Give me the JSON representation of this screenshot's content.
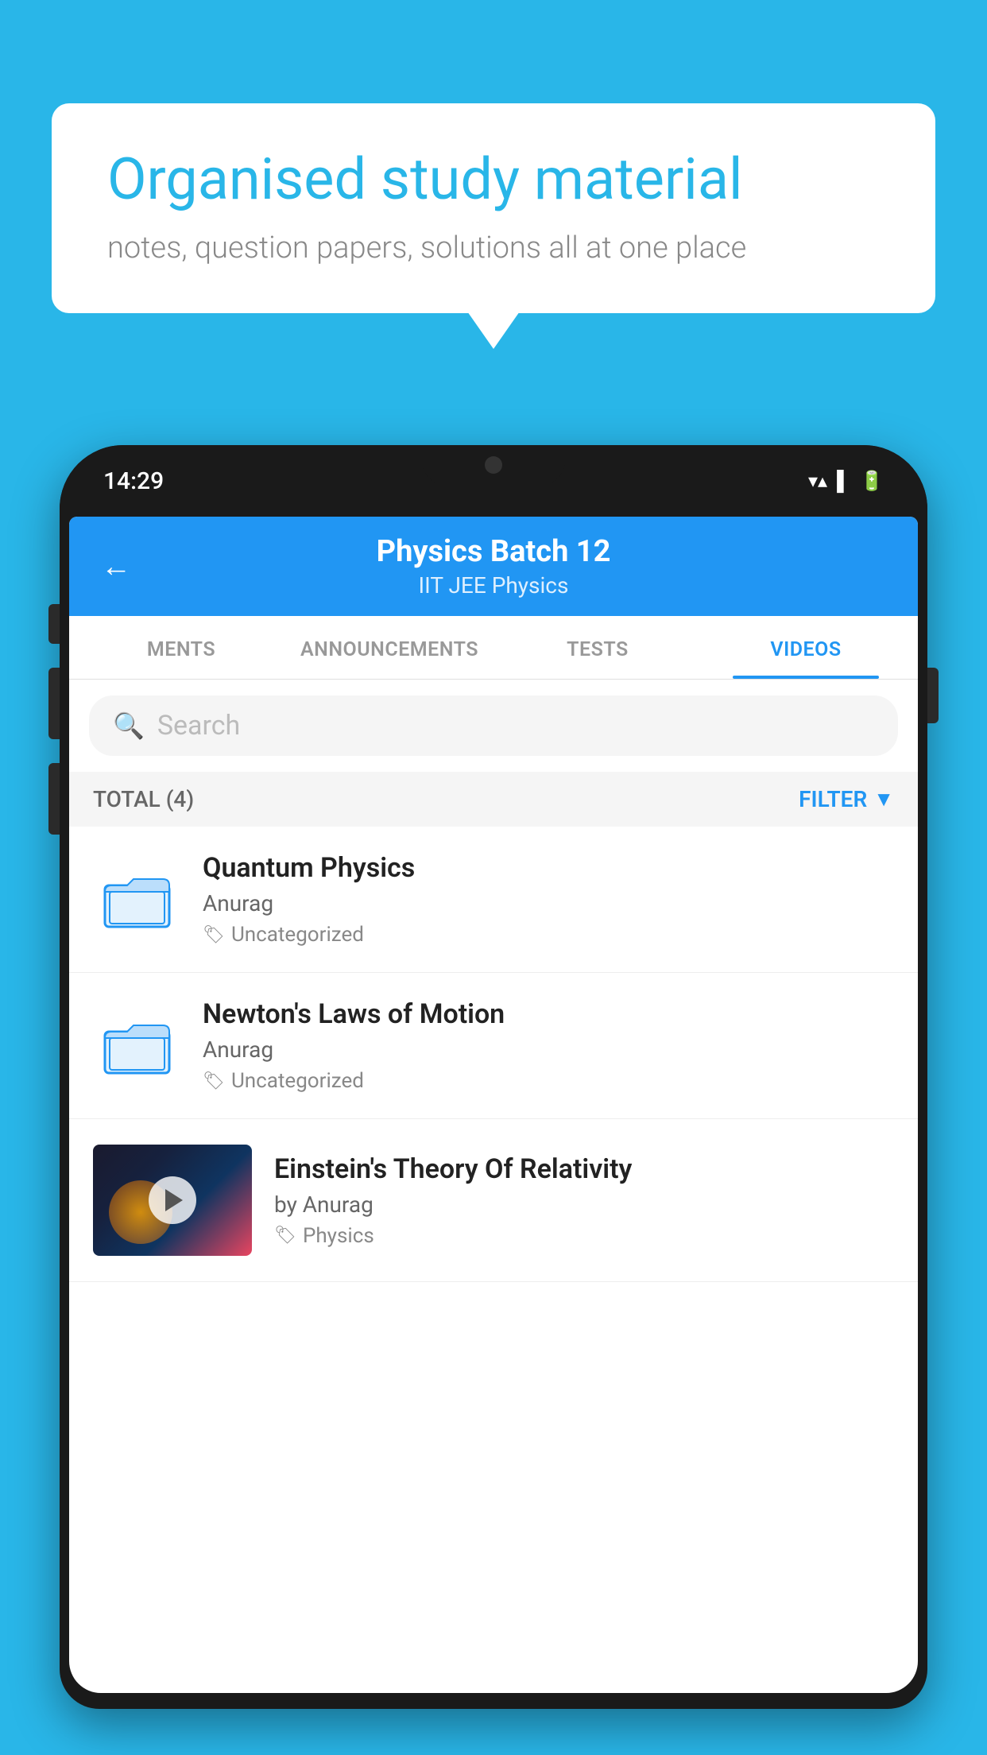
{
  "bubble": {
    "title": "Organised study material",
    "subtitle": "notes, question papers, solutions all at one place"
  },
  "status_bar": {
    "time": "14:29",
    "wifi": "▼",
    "signal": "▲",
    "battery": "▌"
  },
  "header": {
    "title": "Physics Batch 12",
    "subtitle": "IIT JEE   Physics",
    "back_label": "←"
  },
  "tabs": [
    {
      "label": "MENTS",
      "active": false
    },
    {
      "label": "ANNOUNCEMENTS",
      "active": false
    },
    {
      "label": "TESTS",
      "active": false
    },
    {
      "label": "VIDEOS",
      "active": true
    }
  ],
  "search": {
    "placeholder": "Search"
  },
  "filter_bar": {
    "total_label": "TOTAL (4)",
    "filter_label": "FILTER"
  },
  "videos": [
    {
      "title": "Quantum Physics",
      "author": "Anurag",
      "tag": "Uncategorized",
      "has_thumbnail": false
    },
    {
      "title": "Newton's Laws of Motion",
      "author": "Anurag",
      "tag": "Uncategorized",
      "has_thumbnail": false
    },
    {
      "title": "Einstein's Theory Of Relativity",
      "author": "by Anurag",
      "tag": "Physics",
      "has_thumbnail": true
    }
  ],
  "colors": {
    "primary": "#2196f3",
    "sky": "#29b6e8",
    "white": "#ffffff"
  }
}
